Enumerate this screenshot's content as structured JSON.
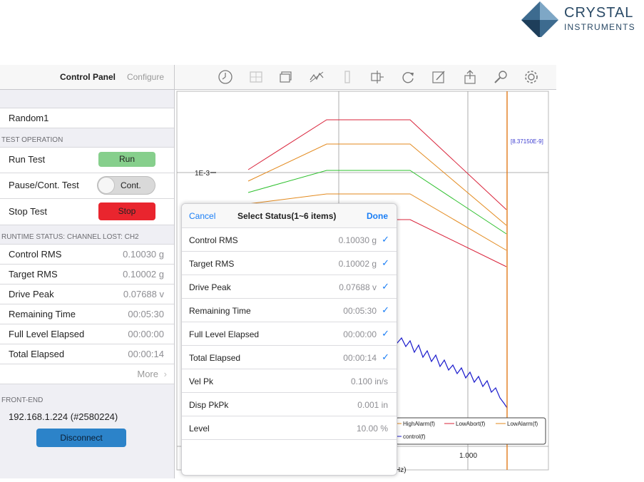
{
  "brand": {
    "line1": "CRYSTAL",
    "line2": "INSTRUMENTS"
  },
  "left_panel": {
    "tab_control": "Control Panel",
    "tab_configure": "Configure",
    "test_name": "Random1",
    "section_operation": "TEST OPERATION",
    "run_label": "Run Test",
    "run_button": "Run",
    "pause_label": "Pause/Cont. Test",
    "pause_toggle": "Cont.",
    "stop_label": "Stop Test",
    "stop_button": "Stop",
    "section_status": "RUNTIME STATUS: CHANNEL LOST: CH2",
    "status_rows": [
      {
        "label": "Control RMS",
        "value": "0.10030 g"
      },
      {
        "label": "Target RMS",
        "value": "0.10002 g"
      },
      {
        "label": "Drive Peak",
        "value": "0.07688 v"
      },
      {
        "label": "Remaining Time",
        "value": "00:05:30"
      },
      {
        "label": "Full Level Elapsed",
        "value": "00:00:00"
      },
      {
        "label": "Total Elapsed",
        "value": "00:00:14"
      }
    ],
    "more": "More",
    "section_frontend": "FRONT-END",
    "frontend_address": "192.168.1.224 (#2580224)",
    "disconnect": "Disconnect"
  },
  "toolbar": {
    "icons": [
      "clock-icon",
      "grid-icon",
      "layers-icon",
      "signal-icon",
      "columns-icon",
      "cursor-icon",
      "refresh-icon",
      "edit-icon",
      "share-icon",
      "search-icon",
      "gear-icon"
    ]
  },
  "chart": {
    "y_tick_label": "1E-3",
    "x_tick_label": "1.000",
    "x_axis_partial": "Hz)",
    "cursor_readout": "[8.37150E-9]",
    "legend": [
      "HighAlarm(f)",
      "LowAbort(f)",
      "LowAlarm(f)",
      "control(f)"
    ],
    "colors": {
      "abort": "#d9233a",
      "alarm": "#e38a1e",
      "target": "#2ec02e",
      "control": "#1a1acc",
      "cursor": "#e07a1a"
    }
  },
  "popover": {
    "cancel": "Cancel",
    "title": "Select Status(1~6 items)",
    "done": "Done",
    "rows": [
      {
        "label": "Control RMS",
        "value": "0.10030 g",
        "checked": true
      },
      {
        "label": "Target RMS",
        "value": "0.10002 g",
        "checked": true
      },
      {
        "label": "Drive Peak",
        "value": "0.07688 v",
        "checked": true
      },
      {
        "label": "Remaining Time",
        "value": "00:05:30",
        "checked": true
      },
      {
        "label": "Full Level Elapsed",
        "value": "00:00:00",
        "checked": true
      },
      {
        "label": "Total Elapsed",
        "value": "00:00:14",
        "checked": true
      },
      {
        "label": "Vel Pk",
        "value": "0.100 in/s",
        "checked": false
      },
      {
        "label": "Disp PkPk",
        "value": "0.001 in",
        "checked": false
      },
      {
        "label": "Level",
        "value": "10.00 %",
        "checked": false
      }
    ],
    "check_glyph": "✓"
  }
}
